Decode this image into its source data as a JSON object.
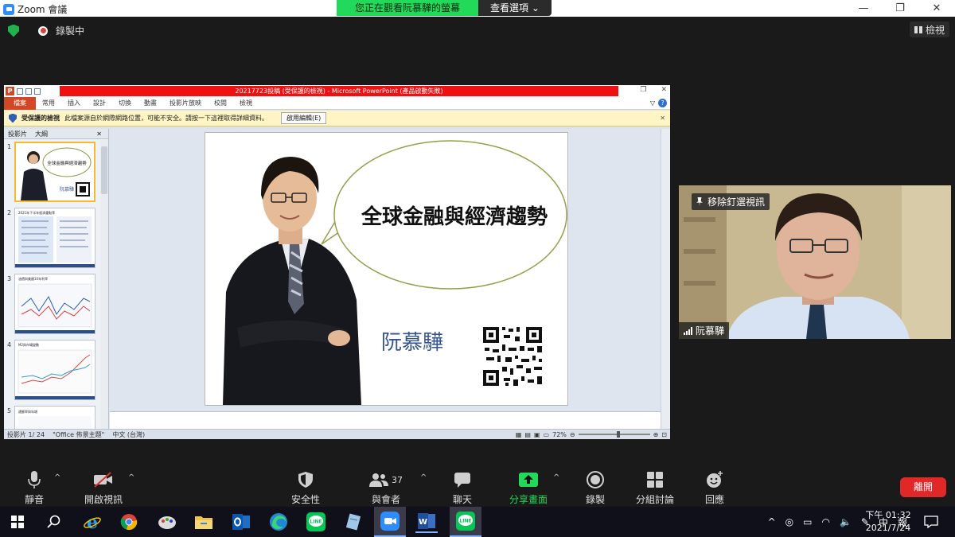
{
  "window": {
    "app_title": "Zoom 會議",
    "viewing_banner": "您正在觀看阮慕驊的螢幕",
    "view_options": "查看選項",
    "recording_label": "錄製中",
    "gallery_label": "檢視",
    "controls": [
      "—",
      "❐",
      "✕"
    ]
  },
  "ppt": {
    "window_title": "20217723投稿 (受保護的檢視) - Microsoft PowerPoint (產品啟動失敗)",
    "file_tab": "檔案",
    "tabs": [
      "常用",
      "插入",
      "設計",
      "切換",
      "動畫",
      "投影片放映",
      "校閱",
      "檢視"
    ],
    "protected_title": "受保護的檢視",
    "protected_message": "此檔案源自於網際網路位置，可能不安全。請按一下這裡取得詳細資料。",
    "enable_editing": "啟用編輯(E)",
    "pane_tabs": [
      "投影片",
      "大綱"
    ],
    "slide_numbers": [
      "1",
      "2",
      "3",
      "4",
      "5"
    ],
    "status_slide": "投影片 1/ 24",
    "status_theme": "\"Office 佈景主題\"",
    "status_lang": "中文 (台灣)",
    "zoom_level": "72%"
  },
  "slide": {
    "title": "全球金融與經濟趨勢",
    "presenter_name": "阮慕驊"
  },
  "thumbs": {
    "t1_title": "全球金融與經濟趨勢",
    "t1_name": "阮慕驊",
    "t2_title": "2021年下半年經濟重點等",
    "t3_title": "油價與美國10年利率",
    "t4_title": "M2與市場變動",
    "t5_title": "通膨率與年增"
  },
  "video": {
    "unpin_label": "移除釘選視訊",
    "participant_name": "阮慕驊"
  },
  "toolbar": {
    "mute": "靜音",
    "start_video": "開啟視訊",
    "security": "安全性",
    "participants": "與會者",
    "participant_count": "37",
    "chat": "聊天",
    "share_screen": "分享畫面",
    "record": "錄製",
    "breakout": "分組討論",
    "reactions": "回應",
    "leave": "離開"
  },
  "taskbar": {
    "time_line1": "下午 01:32",
    "time_line2": "2021/7/24",
    "ime_label": "中",
    "ime_mode": "報"
  },
  "colors": {
    "zoom_bg": "#1a1a1a",
    "share_green": "#23d959",
    "leave_red": "#e02828",
    "ppt_orange": "#d24726"
  }
}
